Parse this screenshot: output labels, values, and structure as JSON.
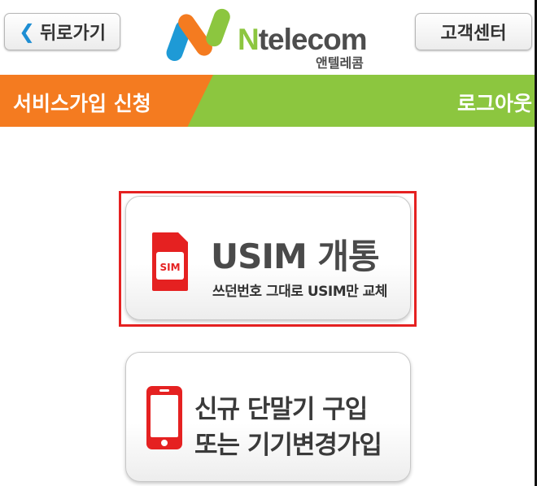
{
  "header": {
    "back_label": "뒤로가기",
    "back_icon": "chevron-left-icon",
    "customer_center_label": "고객센터",
    "logo": {
      "brand_n": "N",
      "brand_rest": "telecom",
      "subtitle": "앤텔레콤"
    }
  },
  "band": {
    "title": "서비스가입 신청",
    "logout_label": "로그아웃",
    "colors": {
      "left": "#f47b20",
      "right": "#8cc63f"
    }
  },
  "options": {
    "usim": {
      "icon": "sim-card-icon",
      "sim_label": "SIM",
      "title": "USIM 개통",
      "subtitle": "쓰던번호 그대로 USIM만 교체",
      "selected": true
    },
    "new_device": {
      "icon": "smartphone-icon",
      "line1": "신규 단말기 구입",
      "line2": "또는 기기변경가입"
    }
  },
  "colors": {
    "accent_red": "#e52121",
    "text_dark": "#3a3a3a"
  }
}
